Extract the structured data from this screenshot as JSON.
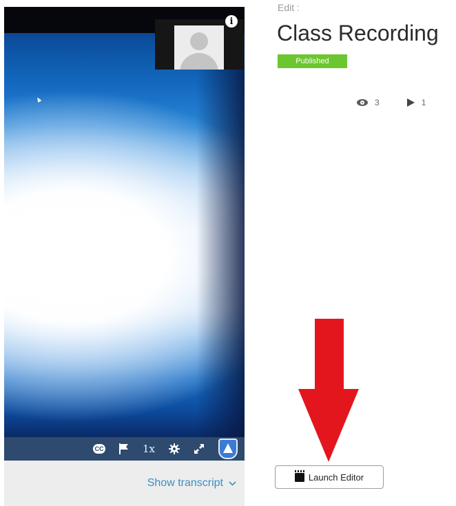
{
  "player": {
    "info_icon_glyph": "i",
    "controls": {
      "cc_label": "CC",
      "speed_label": "1x"
    },
    "show_transcript_label": "Show transcript",
    "transcript_chevron": "⌄"
  },
  "entry": {
    "edit_label": "Edit :",
    "title": "Class Recording",
    "status_badge": "Published",
    "views_count": "3",
    "plays_count": "1"
  },
  "actions": {
    "launch_editor_label": "Launch Editor"
  },
  "colors": {
    "control_bar": "#2e4a6e",
    "published_badge": "#6cc630",
    "link_blue": "#3a8fc6",
    "annotation_arrow": "#e3161e"
  },
  "icons": [
    "info-icon",
    "cc-icon",
    "flag-icon",
    "gear-icon",
    "expand-icon",
    "logo-icon",
    "chevron-down-icon",
    "eye-icon",
    "play-icon",
    "clapperboard-icon",
    "down-arrow-annotation"
  ]
}
